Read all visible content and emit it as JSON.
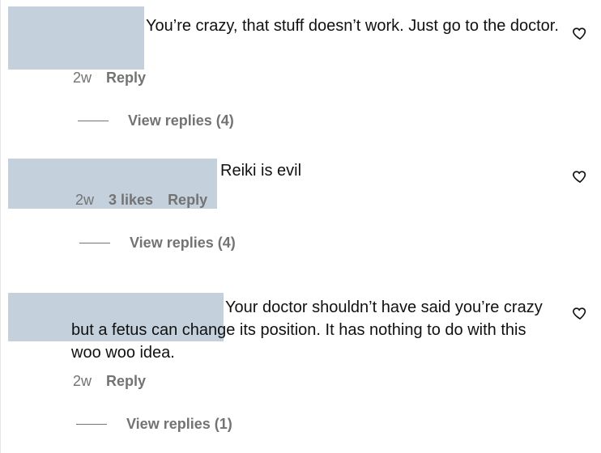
{
  "comments": [
    {
      "text": "You’re crazy, that stuff doesn’t work. Just go to the doctor.",
      "time": "2w",
      "likes": "",
      "reply_label": "Reply",
      "view_replies": "View replies (4)"
    },
    {
      "text": "Reiki is evil",
      "time": "2w",
      "likes": "3 likes",
      "reply_label": "Reply",
      "view_replies": "View replies (4)"
    },
    {
      "text": "Your doctor shouldn’t have said you’re crazy but a fetus can change its position. It has nothing to do with this woo woo idea.",
      "time": "2w",
      "likes": "",
      "reply_label": "Reply",
      "view_replies": "View replies (1)"
    }
  ],
  "icons": {
    "like": "heart-outline-icon"
  }
}
